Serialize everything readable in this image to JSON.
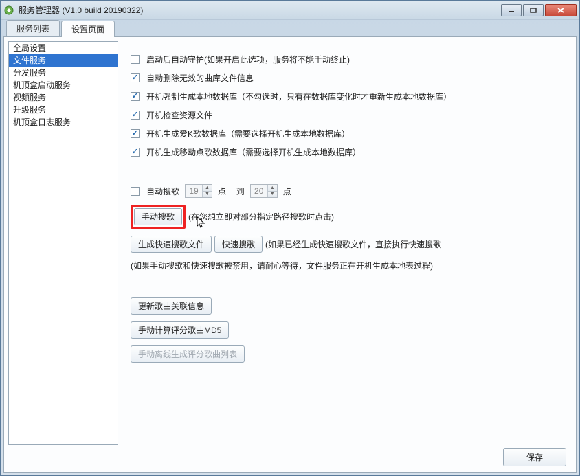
{
  "window": {
    "title": "服务管理器 (V1.0 build 20190322)"
  },
  "tabs": {
    "t0": "服务列表",
    "t1": "设置页面"
  },
  "sidebar": {
    "items": [
      "全局设置",
      "文件服务",
      "分发服务",
      "机顶盒启动服务",
      "视频服务",
      "升级服务",
      "机顶盒日志服务"
    ],
    "selected_index": 1
  },
  "checks": {
    "c0": {
      "label": "启动后自动守护(如果开启此选项，服务将不能手动终止)",
      "checked": false
    },
    "c1": {
      "label": "自动删除无效的曲库文件信息",
      "checked": true
    },
    "c2": {
      "label": "开机强制生成本地数据库（不勾选时，只有在数据库变化时才重新生成本地数据库）",
      "checked": true
    },
    "c3": {
      "label": "开机检查资源文件",
      "checked": true
    },
    "c4": {
      "label": "开机生成爱K歌数据库（需要选择开机生成本地数据库）",
      "checked": true
    },
    "c5": {
      "label": "开机生成移动点歌数据库（需要选择开机生成本地数据库）",
      "checked": true
    },
    "c6": {
      "label": "自动搜歌",
      "checked": false
    }
  },
  "autosearch": {
    "from": "19",
    "to": "20",
    "unit1": "点",
    "sep": "到",
    "unit2": "点"
  },
  "buttons": {
    "manual_search": "手动搜歌",
    "gen_fast_search": "生成快速搜歌文件",
    "fast_search": "快速搜歌",
    "update_assoc": "更新歌曲关联信息",
    "calc_md5": "手动计算评分歌曲MD5",
    "offline_gen": "手动离线生成评分歌曲列表",
    "save": "保存"
  },
  "notes": {
    "manual_search_note": "(在您想立即对部分指定路径搜歌时点击)",
    "fast_search_note": "(如果已经生成快速搜歌文件，直接执行快速搜歌",
    "waiting_note": "(如果手动搜歌和快速搜歌被禁用，请耐心等待，文件服务正在开机生成本地表过程)"
  }
}
